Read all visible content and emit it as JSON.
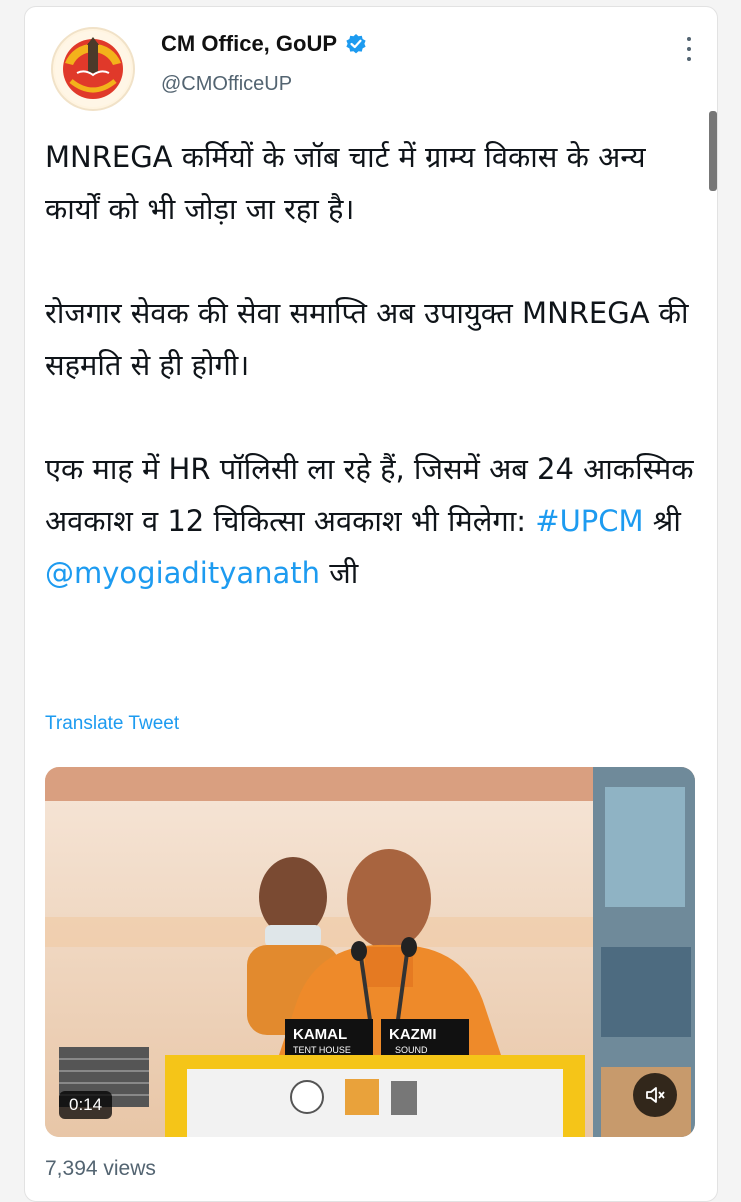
{
  "author": {
    "name": "CM Office, GoUP",
    "handle": "@CMOfficeUP",
    "verified_color": "#1d9bf0"
  },
  "tweet": {
    "paragraph1": "MNREGA कर्मियों के जॉब चार्ट में ग्राम्य विकास के अन्य कार्यों को भी जोड़ा जा रहा है।",
    "paragraph2": "रोजगार सेवक की सेवा समाप्ति अब उपायुक्त MNREGA की सहमति से ही होगी।",
    "paragraph3_text": "एक माह में HR पॉलिसी ला रहे हैं, जिसमें अब 24 आकस्मिक अवकाश व 12 चिकित्सा अवकाश भी मिलेगा:",
    "hashtag": "#UPCM",
    "title_word": "श्री",
    "mention": "@myogiadityanath",
    "suffix": "जी"
  },
  "translate_label": "Translate Tweet",
  "video": {
    "duration": "0:14",
    "podium_left_sign": "KAMAL",
    "podium_left_sub": "TENT HOUSE",
    "podium_right_sign": "KAZMI",
    "podium_right_sub": "SOUND"
  },
  "views": "7,394 views",
  "icons": {
    "verified": "verified-badge-icon",
    "more": "more-vertical-icon",
    "mute": "speaker-muted-icon"
  }
}
